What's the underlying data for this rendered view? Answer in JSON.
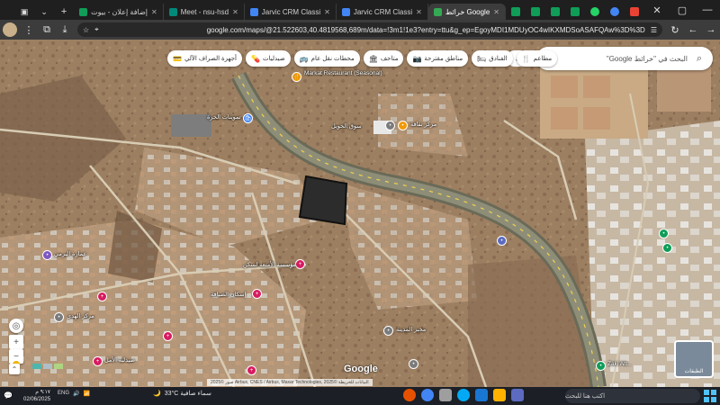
{
  "browser": {
    "tabs": [
      {
        "title": "خرائط Google",
        "active": true,
        "color": "#34a853"
      },
      {
        "title": "Jarvic CRM Classi",
        "active": false,
        "color": "#4285f4"
      },
      {
        "title": "Jarvic CRM Classi",
        "active": false,
        "color": "#4285f4"
      },
      {
        "title": "Meet - nsu-hsd",
        "active": false,
        "color": "#00897b"
      },
      {
        "title": "إضافة إعلان - بيوت",
        "active": false,
        "color": "#0f9d58"
      }
    ],
    "url": "google.com/maps/@21.522603,40.4819568,689m/data=!3m1!1e3?entry=ttu&g_ep=EgoyMDI1MDUyOC4wIKXMDSoASAFQAw%3D%3D",
    "window_controls": {
      "minimize": "—",
      "maximize": "▢",
      "close": "✕"
    },
    "new_tab": "+"
  },
  "maps": {
    "search_placeholder": "البحث في \"خرائط Google\"",
    "chips": [
      {
        "label": "مطاعم",
        "icon": "🍴"
      },
      {
        "label": "الفنادق",
        "icon": "🛏"
      },
      {
        "label": "مناطق مقترحة",
        "icon": "📷"
      },
      {
        "label": "متاحف",
        "icon": "🏛"
      },
      {
        "label": "محطات نقل عام",
        "icon": "🚌"
      },
      {
        "label": "صيدليات",
        "icon": "💊"
      },
      {
        "label": "أجهزة الصراف الآلي",
        "icon": "💳"
      }
    ],
    "more_chip": "٤",
    "labels": [
      "Markat Restaurant (Seasonal)",
      "مطعم ماركات",
      "تموينات الحرة",
      "سوق الحويل",
      "مركز ثقافة",
      "عمارة البرمي",
      "مؤسسة الأمتعة لسكن",
      "إسكان الضيافة",
      "مركز الهدى",
      "صيدلية الأمل",
      "مخبز المدينة",
      "Zaki Alt..."
    ],
    "attribution": "صور ©2025 Airbus, CNES / Airbus, Maxar Technologies, البيانات للخريطة ©2025",
    "google_logo": "Google",
    "layers_label": "الطبقات"
  },
  "taskbar": {
    "search_placeholder": "اكتب هنا للبحث",
    "weather": "33°C سماء صافية",
    "clock_time": "٩:١٧ م",
    "clock_date": "02/06/2025",
    "tray": "ENG"
  }
}
